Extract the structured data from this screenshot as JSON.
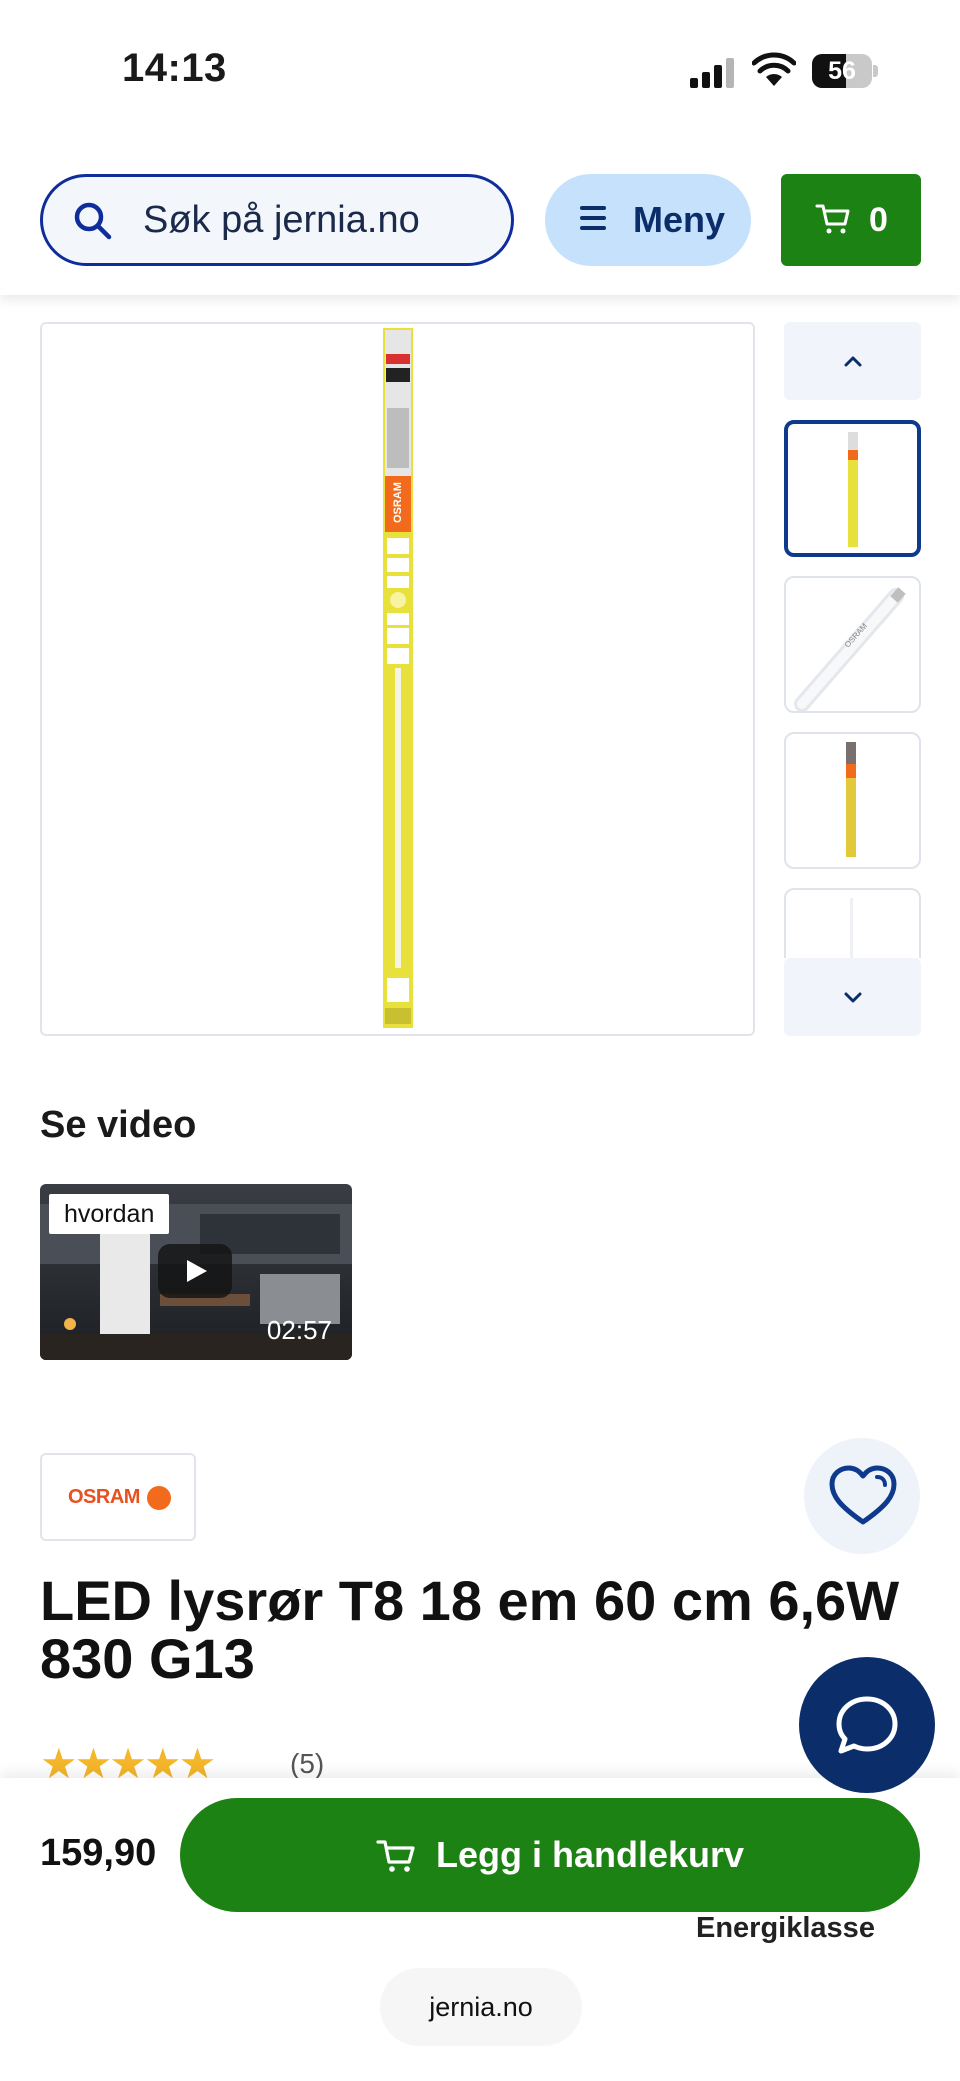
{
  "status_bar": {
    "time": "14:13",
    "battery_percent": 56,
    "battery_label": "56"
  },
  "header": {
    "search_placeholder": "Søk på jernia.no",
    "menu_label": "Meny",
    "cart_count": "0",
    "accent_green": "#1d8214",
    "accent_navy": "#0f2d9a"
  },
  "gallery": {
    "thumbnails": [
      "tube-package-front",
      "tube-angled",
      "tube-package-front-2",
      "tube-plain"
    ],
    "active_index": 0
  },
  "video": {
    "heading": "Se video",
    "tag": "hvordan",
    "duration": "02:57"
  },
  "product": {
    "brand": "OSRAM",
    "title": "LED lysrør T8 18 em 60 cm 6,6W 830 G13",
    "rating_stars": 5,
    "stars_display": "★★★★★",
    "rating_count": "(5)"
  },
  "purchase": {
    "price": "159,90",
    "add_to_cart_label": "Legg i handlekurv",
    "energy_label": "Energiklasse"
  },
  "browser": {
    "url": "jernia.no"
  }
}
